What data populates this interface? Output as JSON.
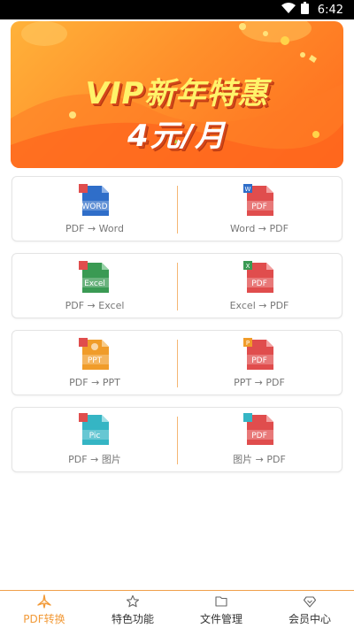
{
  "status_bar": {
    "time": "6:42"
  },
  "banner": {
    "line1": "VIP新年特惠",
    "line2": "4元/月"
  },
  "conversions": [
    {
      "left": {
        "label": "PDF → Word",
        "icon_text": "WORD",
        "icon_color": "#2f6ec9",
        "icon_name": "word-doc-icon"
      },
      "right": {
        "label": "Word → PDF",
        "icon_text": "PDF",
        "icon_color": "#e04d4d",
        "icon_name": "pdf-doc-icon",
        "badge": "W",
        "badge_color": "#2f6ec9"
      }
    },
    {
      "left": {
        "label": "PDF → Excel",
        "icon_text": "Excel",
        "icon_color": "#3a9a53",
        "icon_name": "excel-doc-icon"
      },
      "right": {
        "label": "Excel → PDF",
        "icon_text": "PDF",
        "icon_color": "#e04d4d",
        "icon_name": "pdf-doc-icon",
        "badge": "X",
        "badge_color": "#3a9a53"
      }
    },
    {
      "left": {
        "label": "PDF → PPT",
        "icon_text": "PPT",
        "icon_color": "#f09c2a",
        "icon_name": "ppt-doc-icon"
      },
      "right": {
        "label": "PPT → PDF",
        "icon_text": "PDF",
        "icon_color": "#e04d4d",
        "icon_name": "pdf-doc-icon",
        "badge": "P",
        "badge_color": "#f09c2a"
      }
    },
    {
      "left": {
        "label": "PDF → 图片",
        "icon_text": "Pic",
        "icon_color": "#35b5c4",
        "icon_name": "pic-doc-icon"
      },
      "right": {
        "label": "图片 → PDF",
        "icon_text": "PDF",
        "icon_color": "#e04d4d",
        "icon_name": "pdf-doc-icon",
        "badge": "",
        "badge_color": "#35b5c4"
      }
    }
  ],
  "bottom_nav": [
    {
      "label": "PDF转换",
      "icon": "pdf-convert-icon",
      "active": true
    },
    {
      "label": "特色功能",
      "icon": "star-icon",
      "active": false
    },
    {
      "label": "文件管理",
      "icon": "folder-icon",
      "active": false
    },
    {
      "label": "会员中心",
      "icon": "vip-diamond-icon",
      "active": false
    }
  ],
  "colors": {
    "accent": "#f29a38",
    "divider": "#f5b774",
    "pdf_red": "#e04d4d"
  }
}
